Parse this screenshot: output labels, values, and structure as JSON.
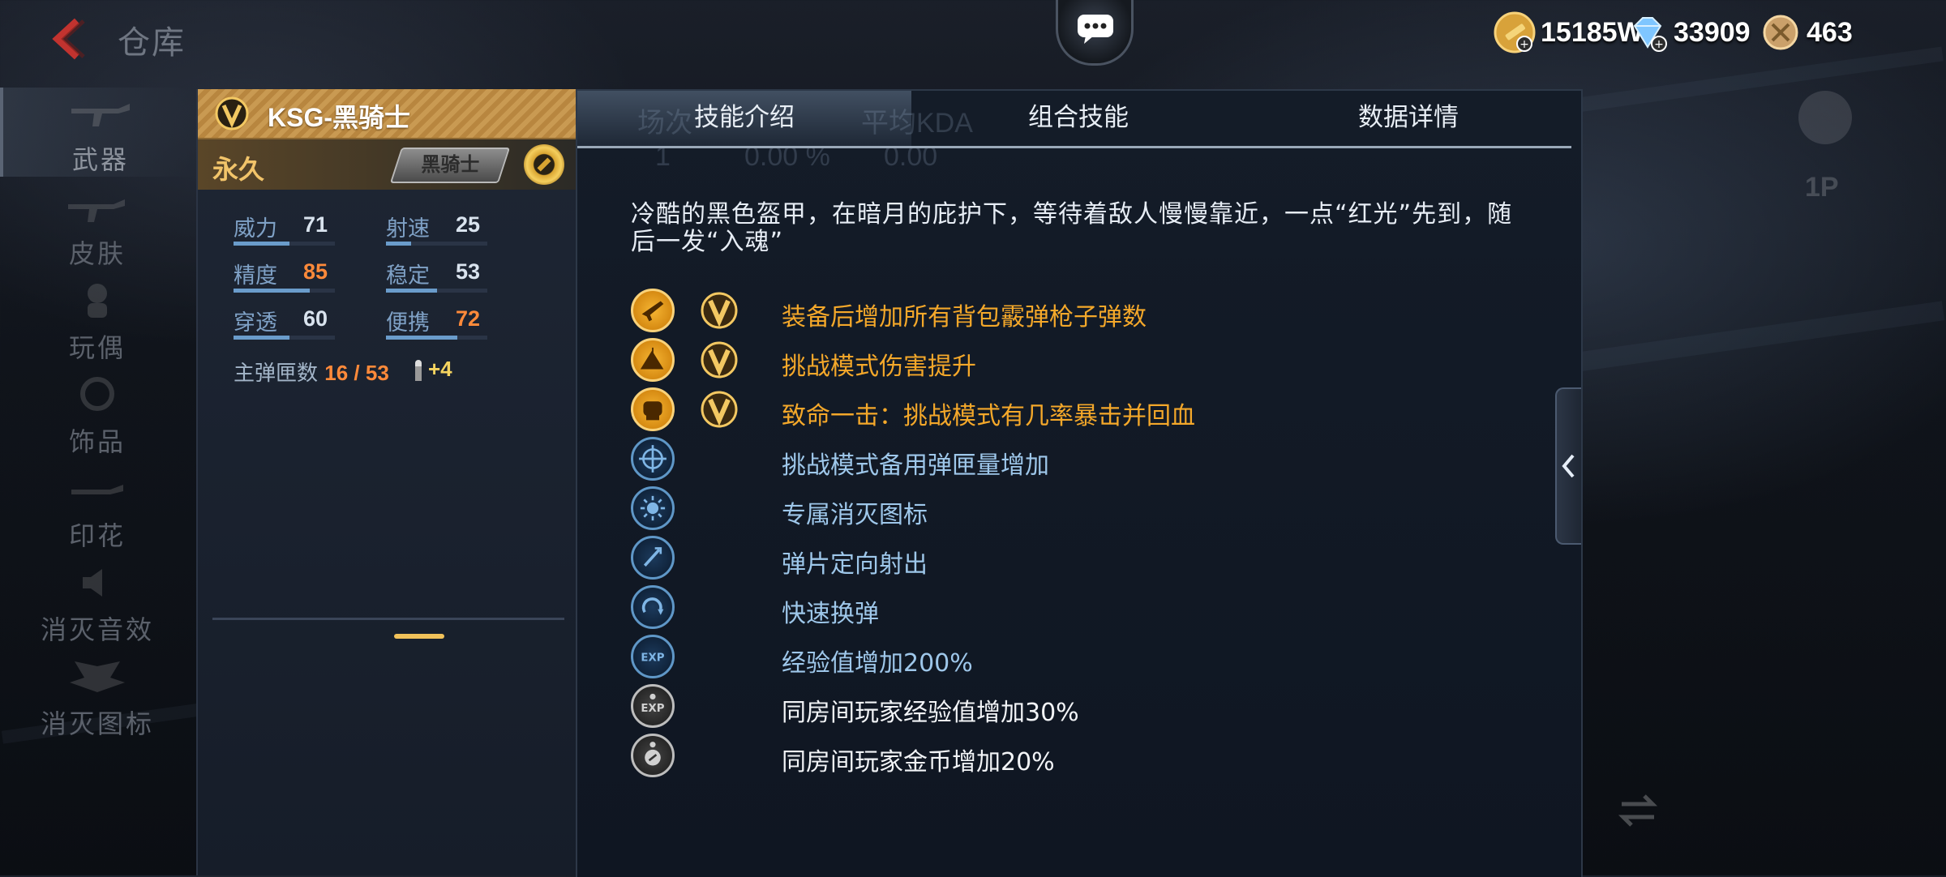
{
  "header": {
    "title": "仓库",
    "currencies": [
      {
        "icon": "gold-coin-icon",
        "value": "15185W"
      },
      {
        "icon": "diamond-icon",
        "value": "33909"
      },
      {
        "icon": "medal-coin-icon",
        "value": "463"
      }
    ]
  },
  "sidebar": {
    "items": [
      {
        "label": "武器",
        "active": true
      },
      {
        "label": "皮肤",
        "active": false
      },
      {
        "label": "玩偶",
        "active": false
      },
      {
        "label": "饰品",
        "active": false
      },
      {
        "label": "印花",
        "active": false
      },
      {
        "label": "消灭音效",
        "active": false
      },
      {
        "label": "消灭图标",
        "active": false
      }
    ]
  },
  "item": {
    "name": "KSG-黑骑士",
    "duration": "永久",
    "tag": "黑骑士",
    "stats": [
      {
        "label": "威力",
        "value": "71",
        "highlight": false,
        "level": 0.55
      },
      {
        "label": "射速",
        "value": "25",
        "highlight": false,
        "level": 0.25
      },
      {
        "label": "精度",
        "value": "85",
        "highlight": true,
        "level": 0.75
      },
      {
        "label": "稳定",
        "value": "53",
        "highlight": false,
        "level": 0.5
      },
      {
        "label": "穿透",
        "value": "60",
        "highlight": false,
        "level": 0.55
      },
      {
        "label": "便携",
        "value": "72",
        "highlight": true,
        "level": 0.7
      }
    ],
    "ammo_label": "主弹匣数",
    "ammo_value": "16 / 53",
    "ammo_bonus": "+4"
  },
  "tabs": [
    {
      "label": "技能介绍",
      "active": true
    },
    {
      "label": "组合技能",
      "active": false
    },
    {
      "label": "数据详情",
      "active": false
    }
  ],
  "ghost_text": {
    "col1": "场次",
    "col2": "平均KDA",
    "val1": "1",
    "val2": "0.00 %",
    "val3": "0.00"
  },
  "description": "冷酷的黑色盔甲，在暗月的庇护下，等待着敌人慢慢靠近，一点“红光”先到，随后一发“入魂”",
  "skills": [
    {
      "icon": "rifle-icon",
      "style": "gold",
      "has_v": true,
      "text": "装备后增加所有背包霰弹枪子弹数"
    },
    {
      "icon": "mountain-flag-icon",
      "style": "gold",
      "has_v": true,
      "text": "挑战模式伤害提升"
    },
    {
      "icon": "fist-icon",
      "style": "gold",
      "has_v": true,
      "text": "致命一击：挑战模式有几率暴击并回血"
    },
    {
      "icon": "crosshair-icon",
      "style": "blue",
      "has_v": false,
      "text": "挑战模式备用弹匣量增加"
    },
    {
      "icon": "starburst-icon",
      "style": "blue",
      "has_v": false,
      "text": "专属消灭图标"
    },
    {
      "icon": "fragment-icon",
      "style": "blue",
      "has_v": false,
      "text": "弹片定向射出"
    },
    {
      "icon": "reload-icon",
      "style": "blue",
      "has_v": false,
      "text": "快速换弹"
    },
    {
      "icon": "exp-icon",
      "style": "blue",
      "has_v": false,
      "text": "经验值增加200%"
    },
    {
      "icon": "exp-group-icon",
      "style": "grey",
      "has_v": false,
      "text": "同房间玩家经验值增加30%"
    },
    {
      "icon": "coin-group-icon",
      "style": "grey",
      "has_v": false,
      "text": "同房间玩家金币增加20%"
    }
  ],
  "right_controls": {
    "p1": "1P"
  },
  "colors": {
    "gold": "#f4a82a",
    "blue": "#9ec7ea",
    "white": "#f2f4f7",
    "accent_orange": "#ff8a3a"
  }
}
